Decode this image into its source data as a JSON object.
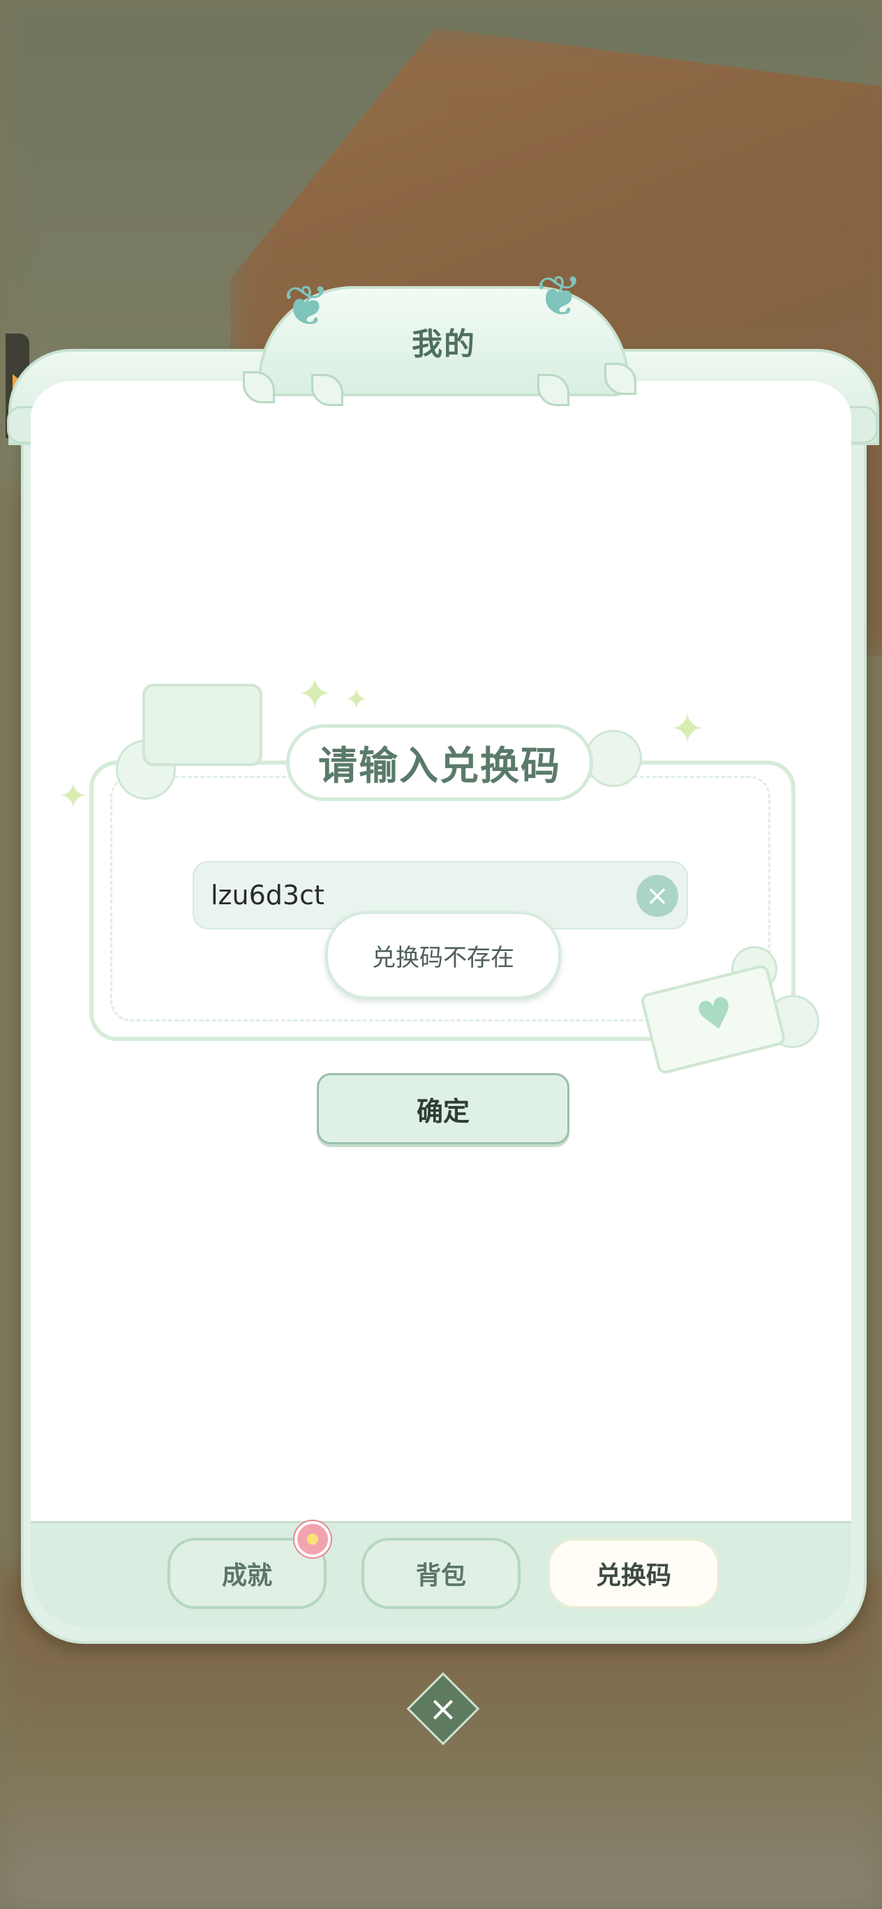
{
  "title": "我的",
  "redeem": {
    "heading": "请输入兑换码",
    "input_value": "lzu6d3ct",
    "error_toast": "兑换码不存在",
    "confirm_label": "确定"
  },
  "tabs": [
    {
      "label": "成就",
      "active": false,
      "badge": true
    },
    {
      "label": "背包",
      "active": false,
      "badge": false
    },
    {
      "label": "兑换码",
      "active": true,
      "badge": false
    }
  ],
  "icons": {
    "clear": "close-circle-icon",
    "close": "close-icon",
    "side": "arrow-right-icon",
    "badge": "flower-icon"
  },
  "colors": {
    "panel": "#e2f1e7",
    "accent": "#5a7a6a",
    "tab_active": "#fffdf5"
  }
}
